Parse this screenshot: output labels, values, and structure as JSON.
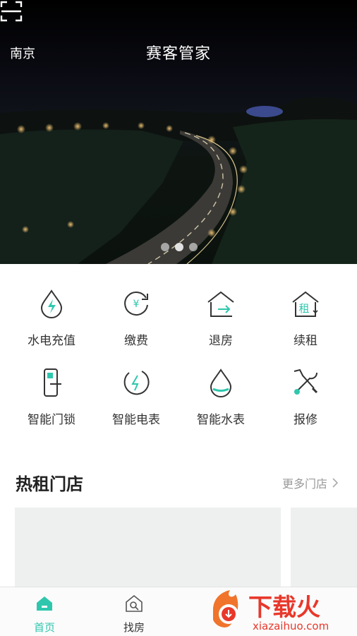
{
  "header": {
    "city": "南京",
    "title": "赛客管家"
  },
  "banner": {
    "slides": 3,
    "active_index": 1
  },
  "services": [
    {
      "label": "水电充值",
      "icon": "water-electric-icon"
    },
    {
      "label": "缴费",
      "icon": "yen-payment-icon"
    },
    {
      "label": "退房",
      "icon": "checkout-house-icon"
    },
    {
      "label": "续租",
      "icon": "renew-lease-icon"
    },
    {
      "label": "智能门锁",
      "icon": "smart-lock-icon"
    },
    {
      "label": "智能电表",
      "icon": "smart-electric-meter-icon"
    },
    {
      "label": "智能水表",
      "icon": "smart-water-meter-icon"
    },
    {
      "label": "报修",
      "icon": "repair-tools-icon"
    }
  ],
  "hot_stores": {
    "title": "热租门店",
    "more_label": "更多门店"
  },
  "tabs": [
    {
      "label": "首页",
      "icon": "home-icon",
      "active": true
    },
    {
      "label": "找房",
      "icon": "find-house-icon",
      "active": false
    }
  ],
  "watermark": {
    "text": "下载火",
    "url": "xiazaihuo.com"
  },
  "colors": {
    "accent": "#2ec7ae",
    "icon_stroke": "#333333",
    "watermark": "#e8382b"
  }
}
